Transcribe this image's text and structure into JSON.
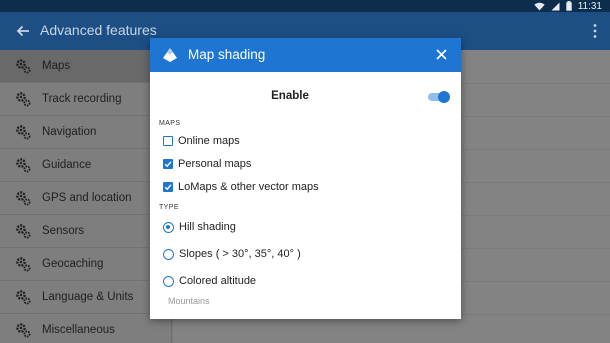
{
  "status": {
    "time": "11:31"
  },
  "appbar": {
    "title": "Advanced features"
  },
  "sidebar": {
    "items": [
      {
        "label": "Maps",
        "icon": "gear-icon",
        "active": true
      },
      {
        "label": "Track recording",
        "icon": "gear-icon"
      },
      {
        "label": "Navigation",
        "icon": "gear-icon"
      },
      {
        "label": "Guidance",
        "icon": "gear-icon"
      },
      {
        "label": "GPS and location",
        "icon": "gear-icon"
      },
      {
        "label": "Sensors",
        "icon": "gear-icon"
      },
      {
        "label": "Geocaching",
        "icon": "gear-icon"
      },
      {
        "label": "Language & Units",
        "icon": "gear-icon"
      },
      {
        "label": "Miscellaneous",
        "icon": "gear-icon"
      }
    ]
  },
  "dialog": {
    "title": "Map shading",
    "enable_label": "Enable",
    "enabled": true,
    "maps_section": "MAPS",
    "maps": [
      {
        "label": "Online maps",
        "checked": false
      },
      {
        "label": "Personal maps",
        "checked": true
      },
      {
        "label": "LoMaps & other vector maps",
        "checked": true
      }
    ],
    "type_section": "TYPE",
    "types": [
      {
        "label": "Hill shading",
        "selected": true
      },
      {
        "label": "Slopes ( > 30°, 35°, 40° )",
        "selected": false
      },
      {
        "label": "Colored altitude",
        "selected": false
      }
    ],
    "type_sublabel": "Mountains"
  },
  "colors": {
    "accent": "#1e76d2",
    "appbar": "#1d4f85",
    "statusbar": "#0d2d4d"
  }
}
